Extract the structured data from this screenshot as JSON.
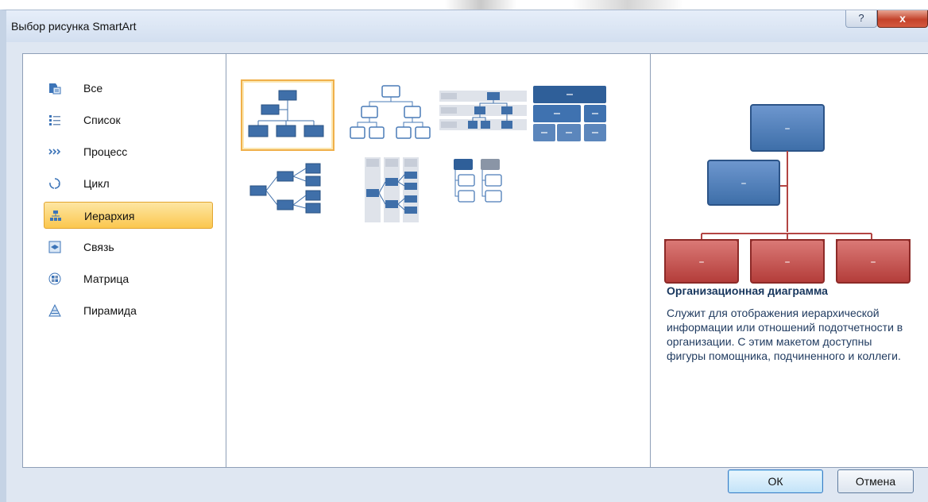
{
  "window": {
    "title": "Выбор рисунка SmartArt",
    "help_label": "?",
    "close_label": "x"
  },
  "categories": [
    {
      "label": "Все",
      "icon": "all-layouts-icon",
      "selected": false
    },
    {
      "label": "Список",
      "icon": "list-icon",
      "selected": false
    },
    {
      "label": "Процесс",
      "icon": "process-icon",
      "selected": false
    },
    {
      "label": "Цикл",
      "icon": "cycle-icon",
      "selected": false
    },
    {
      "label": "Иерархия",
      "icon": "hierarchy-icon",
      "selected": true
    },
    {
      "label": "Связь",
      "icon": "relationship-icon",
      "selected": false
    },
    {
      "label": "Матрица",
      "icon": "matrix-icon",
      "selected": false
    },
    {
      "label": "Пирамида",
      "icon": "pyramid-icon",
      "selected": false
    }
  ],
  "layouts": [
    {
      "name": "organization-chart",
      "selected": true
    },
    {
      "name": "hierarchy",
      "selected": false
    },
    {
      "name": "labeled-hierarchy",
      "selected": false
    },
    {
      "name": "table-hierarchy",
      "selected": false
    },
    {
      "name": "horizontal-hierarchy",
      "selected": false
    },
    {
      "name": "horizontal-labeled-hierarchy",
      "selected": false
    },
    {
      "name": "hierarchy-list",
      "selected": false
    }
  ],
  "preview": {
    "placeholder": "–"
  },
  "description": {
    "title": "Организационная диаграмма",
    "text": "Служит для отображения иерархической информации или отношений подотчетности в организации. С этим макетом доступны фигуры помощника, подчиненного и коллеги."
  },
  "buttons": {
    "ok": "ОК",
    "cancel": "Отмена"
  },
  "colors": {
    "accent_blue": "#3d6ea8",
    "preview_red": "#c64a47",
    "selection_orange": "#fbc74e"
  }
}
